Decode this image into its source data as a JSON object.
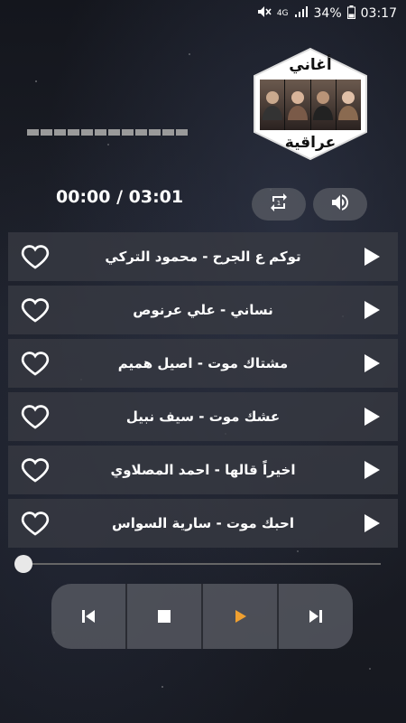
{
  "status_bar": {
    "network": "4G",
    "battery": "34%",
    "time": "03:17"
  },
  "logo": {
    "title_top": "أغاني",
    "title_bottom": "عراقية"
  },
  "player": {
    "time_display": "00:00 / 03:01",
    "seek_position": 0.0
  },
  "songs": [
    {
      "title": "توكم ع الجرح - محمود التركي"
    },
    {
      "title": "نساني - علي عرنوص"
    },
    {
      "title": "مشتاك موت - اصيل هميم"
    },
    {
      "title": "عشك موت - سيف نبيل"
    },
    {
      "title": "اخيراً قالها - احمد المصلاوي"
    },
    {
      "title": "احبك موت - سارية السواس"
    }
  ],
  "colors": {
    "accent_play": "#f0a030",
    "row_bg": "#373942",
    "button_bg": "#5a5c64"
  },
  "icons": {
    "repeat": "repeat-icon",
    "volume": "volume-icon",
    "heart": "heart-outline-icon",
    "play": "play-icon",
    "prev": "skip-previous-icon",
    "stop": "stop-icon",
    "next": "skip-next-icon"
  }
}
